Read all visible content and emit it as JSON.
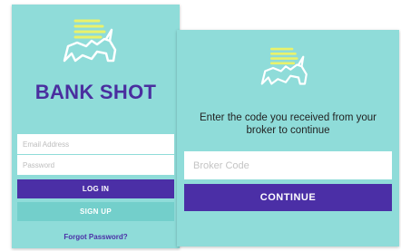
{
  "colors": {
    "background": "#8fdcd9",
    "brand_purple": "#4b2fa6",
    "brand_text": "#4a2e9f",
    "signup_button": "#73cfcb",
    "logo_lines": "#e9f26b"
  },
  "login_screen": {
    "logo_icon": "rhino-logo-icon",
    "brand_name": "BANK SHOT",
    "email_placeholder": "Email Address",
    "password_placeholder": "Password",
    "login_label": "LOG IN",
    "signup_label": "SIGN UP",
    "forgot_label": "Forgot Password?"
  },
  "broker_screen": {
    "logo_icon": "rhino-logo-icon",
    "prompt": "Enter the code you received from your broker to continue",
    "code_placeholder": "Broker Code",
    "continue_label": "CONTINUE"
  }
}
